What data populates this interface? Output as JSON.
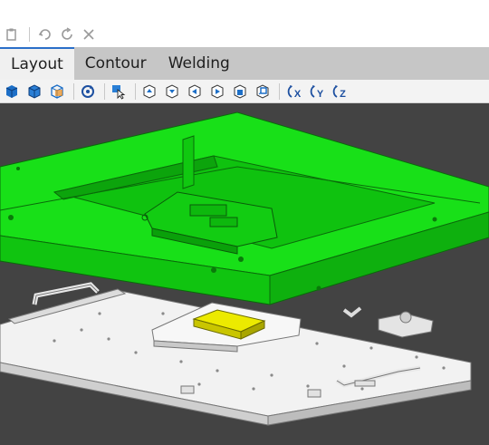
{
  "edit_toolbar": {
    "buttons": [
      {
        "name": "paste",
        "icon": "paste-icon",
        "glyph": "📋"
      },
      {
        "name": "undo",
        "icon": "undo-icon",
        "glyph": "↶"
      },
      {
        "name": "redo",
        "icon": "redo-icon",
        "glyph": "↻"
      },
      {
        "name": "delete",
        "icon": "close-icon",
        "glyph": "✕"
      }
    ]
  },
  "tabs": [
    {
      "label": "Layout",
      "active": true
    },
    {
      "label": "Contour",
      "active": false
    },
    {
      "label": "Welding",
      "active": false
    }
  ],
  "view_toolbar": {
    "rotate_x_label": "X",
    "rotate_y_label": "Y",
    "rotate_z_label": "Z"
  },
  "viewport": {
    "background": "#434343",
    "upper_part_color": "#12d412",
    "lower_part_color": "#e6e6e6",
    "selected_part_color": "#e7e000"
  }
}
